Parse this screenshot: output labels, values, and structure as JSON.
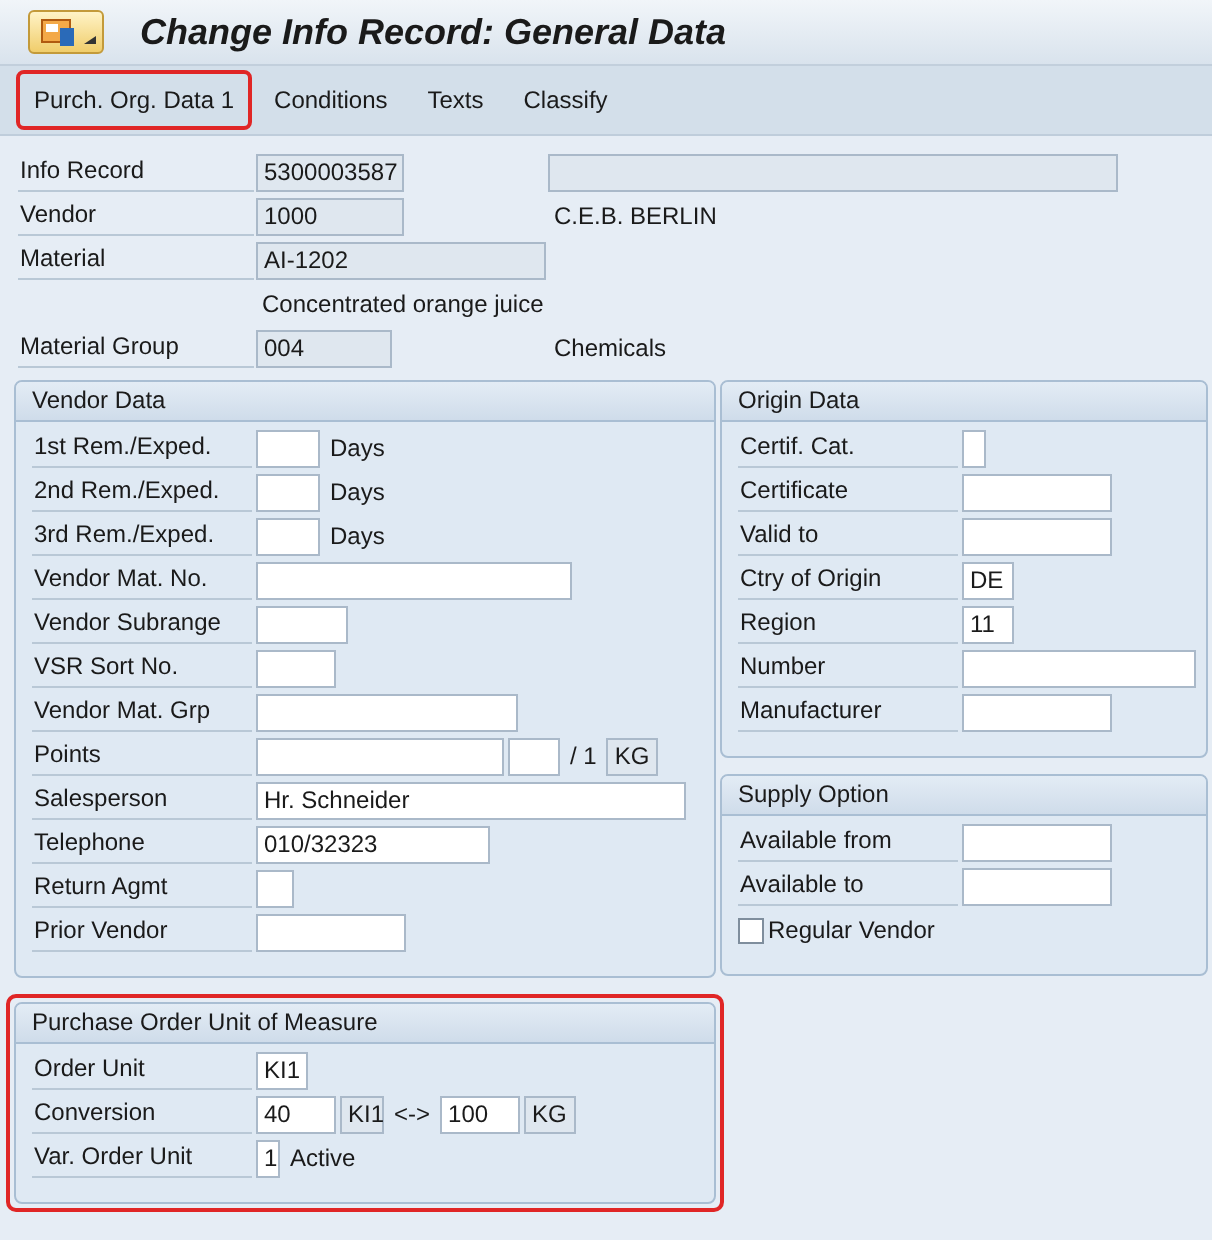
{
  "window": {
    "title": "Change Info Record: General Data"
  },
  "tabs": [
    {
      "label": "Purch. Org. Data 1",
      "highlighted": true
    },
    {
      "label": "Conditions",
      "highlighted": false
    },
    {
      "label": "Texts",
      "highlighted": false
    },
    {
      "label": "Classify",
      "highlighted": false
    }
  ],
  "header": {
    "rows": [
      {
        "label": "Info Record",
        "parts": [
          {
            "kind": "field",
            "value": "5300003587",
            "editable": false
          },
          {
            "kind": "field",
            "editable": false
          }
        ]
      },
      {
        "label": "Vendor",
        "parts": [
          {
            "kind": "field",
            "value": "1000",
            "editable": false
          },
          {
            "kind": "text",
            "value": "C.E.B. BERLIN"
          }
        ]
      },
      {
        "label": "Material",
        "parts": [
          {
            "kind": "field",
            "value": "AI-1202",
            "editable": false
          }
        ]
      },
      {
        "parts": [
          {
            "kind": "text",
            "value": "Concentrated orange juice"
          }
        ]
      },
      {
        "label": "Material Group",
        "parts": [
          {
            "kind": "field",
            "value": "004",
            "editable": false
          },
          {
            "kind": "text",
            "value": "Chemicals"
          }
        ]
      }
    ]
  },
  "columns": [
    {
      "groups": [
        {
          "title": "Vendor Data",
          "highlighted": false,
          "rows": [
            {
              "label": "1st Rem./Exped.",
              "parts": [
                {
                  "kind": "field",
                  "editable": true
                },
                {
                  "kind": "text",
                  "value": "Days"
                }
              ]
            },
            {
              "label": "2nd Rem./Exped.",
              "parts": [
                {
                  "kind": "field",
                  "editable": true
                },
                {
                  "kind": "text",
                  "value": "Days"
                }
              ]
            },
            {
              "label": "3rd Rem./Exped.",
              "parts": [
                {
                  "kind": "field",
                  "editable": true
                },
                {
                  "kind": "text",
                  "value": "Days"
                }
              ]
            },
            {
              "label": "Vendor Mat. No.",
              "parts": [
                {
                  "kind": "field",
                  "editable": true
                }
              ]
            },
            {
              "label": "Vendor Subrange",
              "parts": [
                {
                  "kind": "field",
                  "editable": true
                }
              ]
            },
            {
              "label": "VSR Sort No.",
              "parts": [
                {
                  "kind": "field",
                  "editable": true
                }
              ]
            },
            {
              "label": "Vendor Mat. Grp",
              "parts": [
                {
                  "kind": "field",
                  "editable": true
                }
              ]
            },
            {
              "label": "Points",
              "parts": [
                {
                  "kind": "field",
                  "editable": true
                },
                {
                  "kind": "field",
                  "editable": true
                },
                {
                  "kind": "text",
                  "value": "/ 1"
                },
                {
                  "kind": "field",
                  "value": "KG",
                  "editable": false
                }
              ]
            },
            {
              "label": "Salesperson",
              "parts": [
                {
                  "kind": "field",
                  "value": "Hr. Schneider",
                  "editable": true
                }
              ]
            },
            {
              "label": "Telephone",
              "parts": [
                {
                  "kind": "field",
                  "value": "010/32323",
                  "editable": true
                }
              ]
            },
            {
              "label": "Return Agmt",
              "parts": [
                {
                  "kind": "field",
                  "editable": true
                }
              ]
            },
            {
              "label": "Prior Vendor",
              "parts": [
                {
                  "kind": "field",
                  "editable": true
                }
              ]
            }
          ]
        },
        {
          "title": "Purchase Order Unit of Measure",
          "highlighted": true,
          "rows": [
            {
              "label": "Order Unit",
              "parts": [
                {
                  "kind": "field",
                  "value": "KI1",
                  "editable": true
                }
              ]
            },
            {
              "label": "Conversion",
              "parts": [
                {
                  "kind": "field",
                  "value": "40",
                  "editable": true
                },
                {
                  "kind": "field",
                  "value": "KI1",
                  "editable": false
                },
                {
                  "kind": "text",
                  "value": "<->"
                },
                {
                  "kind": "field",
                  "value": "100",
                  "editable": true
                },
                {
                  "kind": "field",
                  "value": "KG",
                  "editable": false
                }
              ]
            },
            {
              "label": "Var. Order Unit",
              "parts": [
                {
                  "kind": "field",
                  "value": "1",
                  "editable": true
                },
                {
                  "kind": "text",
                  "value": "Active"
                }
              ]
            }
          ]
        }
      ]
    },
    {
      "groups": [
        {
          "title": "Origin Data",
          "highlighted": false,
          "rows": [
            {
              "label": "Certif. Cat.",
              "parts": [
                {
                  "kind": "field",
                  "editable": true
                }
              ]
            },
            {
              "label": "Certificate",
              "parts": [
                {
                  "kind": "field",
                  "editable": true
                }
              ]
            },
            {
              "label": "Valid to",
              "parts": [
                {
                  "kind": "field",
                  "editable": true
                }
              ]
            },
            {
              "label": "Ctry of Origin",
              "parts": [
                {
                  "kind": "field",
                  "value": "DE",
                  "editable": true
                }
              ]
            },
            {
              "label": "Region",
              "parts": [
                {
                  "kind": "field",
                  "value": "11",
                  "editable": true
                }
              ]
            },
            {
              "label": "Number",
              "parts": [
                {
                  "kind": "field",
                  "editable": true
                }
              ]
            },
            {
              "label": "Manufacturer",
              "parts": [
                {
                  "kind": "field",
                  "editable": true
                }
              ]
            }
          ]
        },
        {
          "title": "Supply Option",
          "highlighted": false,
          "rows": [
            {
              "label": "Available from",
              "parts": [
                {
                  "kind": "field",
                  "editable": true
                }
              ]
            },
            {
              "label": "Available to",
              "parts": [
                {
                  "kind": "field",
                  "editable": true
                }
              ]
            },
            {
              "kind": "checkbox",
              "label": "Regular Vendor",
              "checked": false
            }
          ]
        }
      ]
    }
  ]
}
